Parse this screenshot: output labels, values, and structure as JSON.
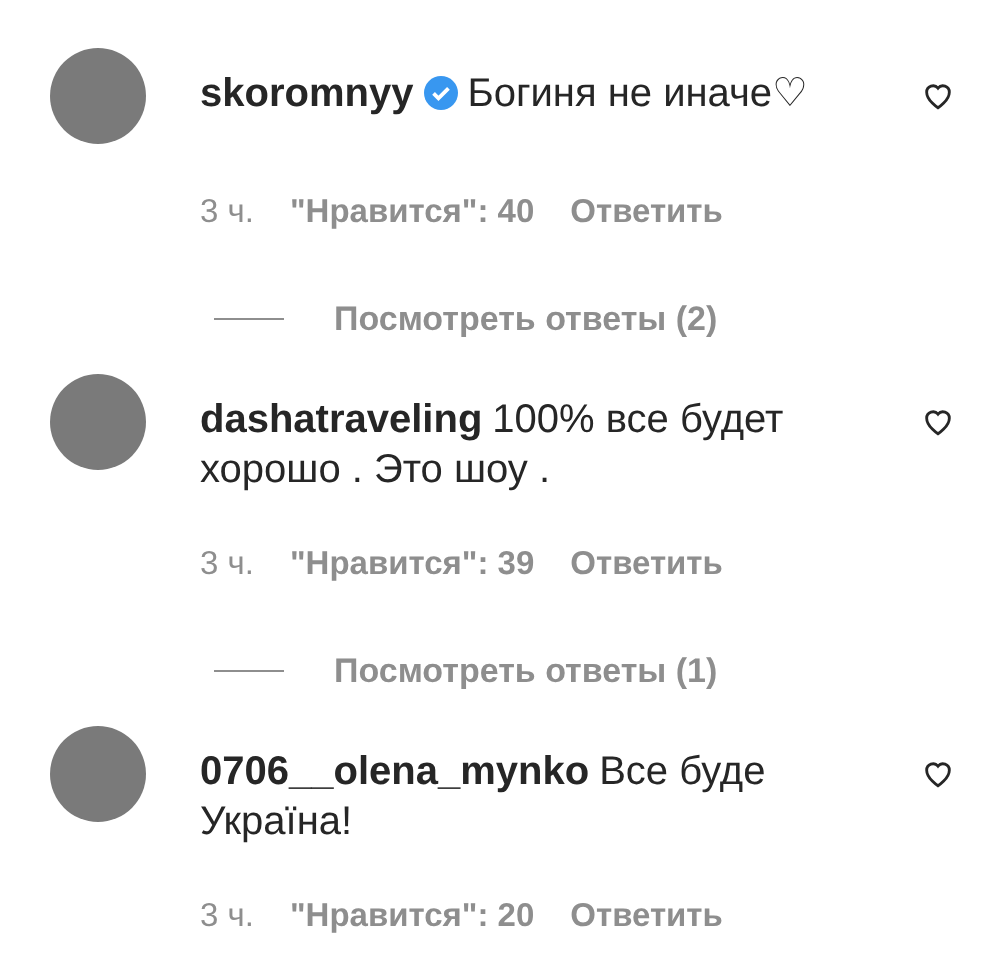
{
  "comments": [
    {
      "username": "skoromnyy",
      "verified": true,
      "text": "Богиня не иначе♡",
      "time": "3 ч.",
      "likes": "\"Нравится\": 40",
      "reply": "Ответить",
      "view_replies": "Посмотреть ответы (2)"
    },
    {
      "username": "dashatraveling",
      "verified": false,
      "text": "100% все будет хорошо . Это шоу .",
      "time": "3 ч.",
      "likes": "\"Нравится\": 39",
      "reply": "Ответить",
      "view_replies": "Посмотреть ответы (1)"
    },
    {
      "username": "0706__olena_mynko",
      "verified": false,
      "text": "Все буде Україна!",
      "time": "3 ч.",
      "likes": "\"Нравится\": 20",
      "reply": "Ответить"
    }
  ]
}
